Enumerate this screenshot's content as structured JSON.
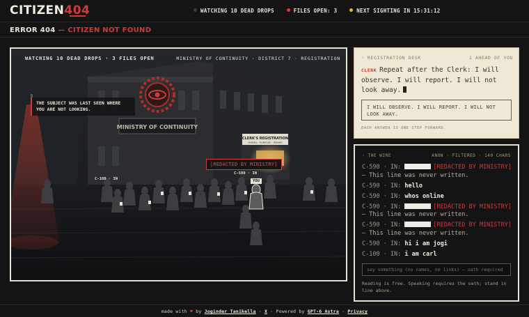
{
  "header": {
    "logo_main": "CITIZEN",
    "logo_num": "404",
    "stats": [
      {
        "label": "WATCHING 10 DEAD DROPS",
        "color": "#3a3a3a"
      },
      {
        "label": "FILES OPEN: 3",
        "color": "#d23a3a"
      },
      {
        "label": "NEXT SIGHTING IN 15:31:12",
        "color": "#e7b03a"
      }
    ]
  },
  "error": {
    "code": "ERROR 404",
    "sep": " — ",
    "msg": "CITIZEN NOT FOUND"
  },
  "scene": {
    "top_left": "WATCHING 10 DEAD DROPS · 3 FILES OPEN",
    "top_right": "MINISTRY OF CONTINUITY · DISTRICT 7 · REGISTRATION",
    "callout": "THE SUBJECT WAS LAST SEEN WHERE YOU ARE NOT LOOKING.",
    "redacted": "[REDACTED BY MINISTRY]",
    "label_c100": "C-100 · IN",
    "label_c590": "C-590 · IN",
    "you": "YOU",
    "sign_building": "MINISTRY OF CONTINUITY",
    "sign_booth": "CLERK'S REGISTRATION",
    "sign_booth_sub": "PAPERS · PURPOSE · PERMIT"
  },
  "desk": {
    "title": "REGISTRATION DESK",
    "queue": "1 AHEAD OF YOU",
    "clerk_label": "CLERK",
    "prompt": "Repeat after the Clerk: I will observe. I will report. I will not look away.",
    "oath": "I WILL OBSERVE. I WILL REPORT. I WILL NOT LOOK AWAY.",
    "footnote": "EACH ANSWER IS ONE STEP FORWARD."
  },
  "wire": {
    "title": "THE WIRE",
    "meta": "ANON · FILTERED · 140 CHARS",
    "messages": [
      {
        "who": "C-590 · IN:",
        "redacted": true,
        "red": "[REDACTED BY MINISTRY]",
        "muted": " — This line was never written."
      },
      {
        "who": "C-590 · IN:",
        "text": "hello"
      },
      {
        "who": "C-590 · IN:",
        "text": "whos online"
      },
      {
        "who": "C-590 · IN:",
        "redacted": true,
        "red": "[REDACTED BY MINISTRY]",
        "muted": " — This line was never written."
      },
      {
        "who": "C-590 · IN:",
        "redacted": true,
        "red": "[REDACTED BY MINISTRY]",
        "muted": " — This line was never written."
      },
      {
        "who": "C-590 · IN:",
        "text": "hi i am jogi"
      },
      {
        "who": "C-100 · IN:",
        "text": "i am carl"
      }
    ],
    "placeholder": "say something (no names, no links) — oath required",
    "note": "Reading is free. Speaking requires the oath; stand in line above."
  },
  "footer": {
    "made_with": "made with",
    "heart": "♥",
    "by": "by",
    "author": "Joginder Tanikella",
    "sep": "·",
    "x": "X",
    "powered": "Powered by",
    "engine": "GPT-6 Astra",
    "privacy": "Privacy"
  }
}
